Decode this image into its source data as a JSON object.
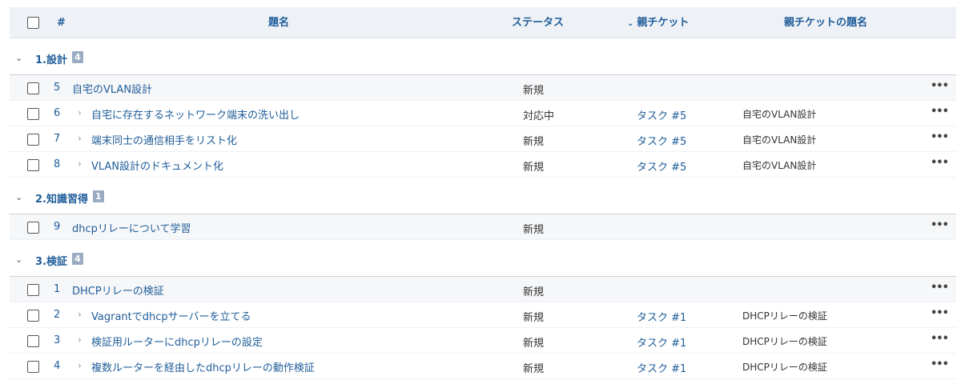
{
  "header": {
    "num": "#",
    "subject": "題名",
    "status": "ステータス",
    "parent": "親チケット",
    "parent_subject": "親チケットの題名"
  },
  "groups": [
    {
      "name": "1.設計",
      "count": "4",
      "rows": [
        {
          "id": "5",
          "subject": "自宅のVLAN設計",
          "status": "新規",
          "parent": "",
          "parent_subject": "",
          "child": false
        },
        {
          "id": "6",
          "subject": "自宅に存在するネットワーク端末の洗い出し",
          "status": "対応中",
          "parent": "タスク #5",
          "parent_subject": "自宅のVLAN設計",
          "child": true
        },
        {
          "id": "7",
          "subject": "端末同士の通信相手をリスト化",
          "status": "新規",
          "parent": "タスク #5",
          "parent_subject": "自宅のVLAN設計",
          "child": true
        },
        {
          "id": "8",
          "subject": "VLAN設計のドキュメント化",
          "status": "新規",
          "parent": "タスク #5",
          "parent_subject": "自宅のVLAN設計",
          "child": true
        }
      ]
    },
    {
      "name": "2.知識習得",
      "count": "1",
      "rows": [
        {
          "id": "9",
          "subject": "dhcpリレーについて学習",
          "status": "新規",
          "parent": "",
          "parent_subject": "",
          "child": false
        }
      ]
    },
    {
      "name": "3.検証",
      "count": "4",
      "rows": [
        {
          "id": "1",
          "subject": "DHCPリレーの検証",
          "status": "新規",
          "parent": "",
          "parent_subject": "",
          "child": false
        },
        {
          "id": "2",
          "subject": "Vagrantでdhcpサーバーを立てる",
          "status": "新規",
          "parent": "タスク #1",
          "parent_subject": "DHCPリレーの検証",
          "child": true
        },
        {
          "id": "3",
          "subject": "検証用ルーターにdhcpリレーの設定",
          "status": "新規",
          "parent": "タスク #1",
          "parent_subject": "DHCPリレーの検証",
          "child": true
        },
        {
          "id": "4",
          "subject": "複数ルーターを経由したdhcpリレーの動作検証",
          "status": "新規",
          "parent": "タスク #1",
          "parent_subject": "DHCPリレーの検証",
          "child": true
        }
      ]
    }
  ],
  "icons": {
    "group_toggle": "chevron-down-icon",
    "sort": "chevron-down-icon",
    "child_indicator": "chevron-right-icon",
    "row_menu": "more-icon"
  },
  "colors": {
    "link": "#1f5d99",
    "header_bg": "#eef1f6",
    "count_badge": "#9aacc2"
  }
}
